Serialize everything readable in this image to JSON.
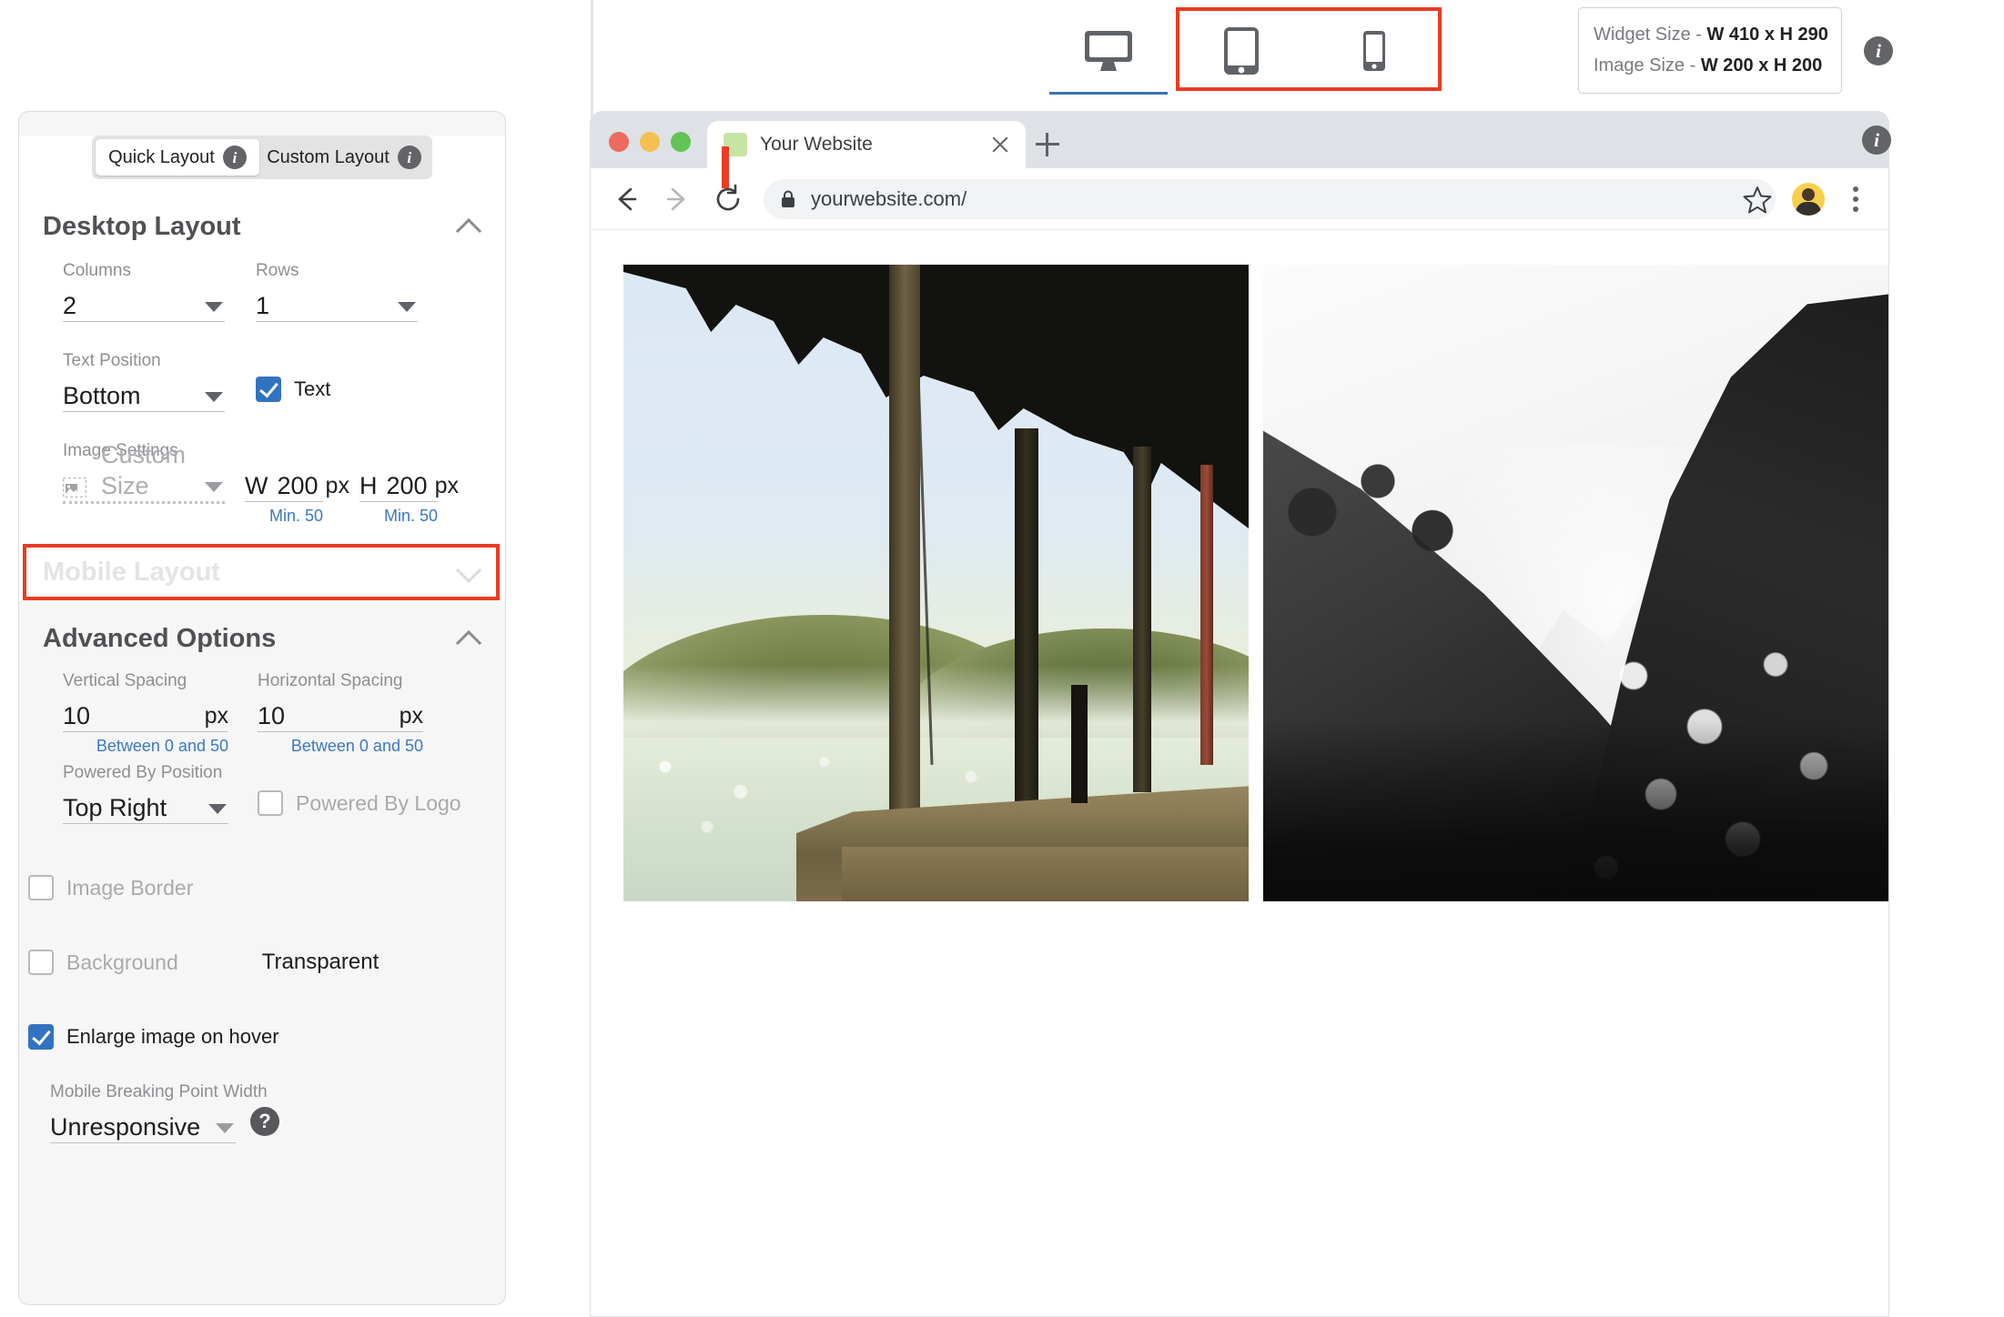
{
  "topbar": {
    "devices": [
      {
        "name": "desktop",
        "label": "Desktop",
        "active": true
      },
      {
        "name": "tablet",
        "label": "Tablet",
        "active": false
      },
      {
        "name": "mobile",
        "label": "Mobile",
        "active": false
      }
    ],
    "size_box": {
      "widget_label": "Widget Size - ",
      "widget_value": "W 410 x H 290",
      "image_label": "Image Size - ",
      "image_value": "W 200 x H 200"
    },
    "info_icon": "i"
  },
  "panel": {
    "segmented": {
      "quick_label": "Quick Layout",
      "custom_label": "Custom Layout",
      "badge": "i"
    },
    "desktop_layout": {
      "title": "Desktop Layout",
      "columns_label": "Columns",
      "columns_value": "2",
      "rows_label": "Rows",
      "rows_value": "1",
      "text_position_label": "Text Position",
      "text_position_value": "Bottom",
      "text_checkbox_label": "Text",
      "text_checkbox_checked": true,
      "image_settings_label": "Image Settings",
      "image_settings_value": "Custom Size",
      "width_prefix": "W",
      "width_value": "200",
      "width_unit": "px",
      "width_helper": "Min. 50",
      "height_prefix": "H",
      "height_value": "200",
      "height_unit": "px",
      "height_helper": "Min. 50"
    },
    "mobile_layout": {
      "title": "Mobile Layout"
    },
    "advanced_options": {
      "title": "Advanced Options",
      "vertical_spacing_label": "Vertical Spacing",
      "vertical_spacing_value": "10",
      "vertical_spacing_unit": "px",
      "vertical_spacing_helper": "Between 0 and 50",
      "horizontal_spacing_label": "Horizontal Spacing",
      "horizontal_spacing_value": "10",
      "horizontal_spacing_unit": "px",
      "horizontal_spacing_helper": "Between 0 and 50",
      "powered_by_position_label": "Powered By Position",
      "powered_by_position_value": "Top Right",
      "powered_by_logo_label": "Powered By Logo",
      "powered_by_logo_checked": false,
      "image_border_label": "Image Border",
      "image_border_checked": false,
      "background_label": "Background",
      "background_checked": false,
      "background_value": "Transparent",
      "enlarge_label": "Enlarge image on hover",
      "enlarge_checked": true,
      "breakpoint_label": "Mobile Breaking Point Width",
      "breakpoint_value": "Unresponsive",
      "help_icon": "?"
    }
  },
  "browser": {
    "tab_title": "Your Website",
    "url": "yourwebsite.com/",
    "info_icon": "i"
  },
  "colors": {
    "accent_blue": "#3273c0",
    "tab_underline": "#3f72b5",
    "annotation_red": "#eb3b22",
    "helper_blue": "#3b78c3",
    "panel_bg": "#f6f6f6"
  }
}
